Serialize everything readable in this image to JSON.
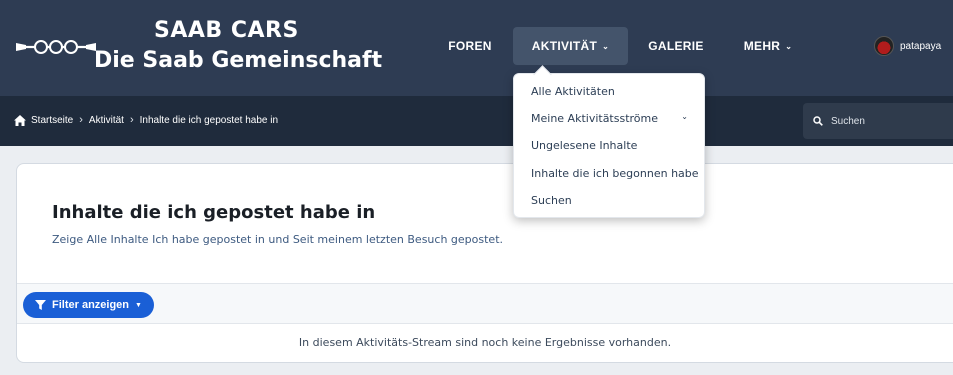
{
  "brand": {
    "line1": "SAAB CARS",
    "line2": "Die Saab Gemeinschaft",
    "logo_icon": "saab-propeller-logo"
  },
  "nav": {
    "items": [
      {
        "label": "FOREN"
      },
      {
        "label": "AKTIVITÄT"
      },
      {
        "label": "GALERIE"
      },
      {
        "label": "MEHR"
      }
    ]
  },
  "user": {
    "name": "patapaya"
  },
  "breadcrumb": {
    "home": "Startseite",
    "level1": "Aktivität",
    "current": "Inhalte die ich gepostet habe in"
  },
  "search": {
    "placeholder": "Suchen"
  },
  "dropdown": {
    "items": [
      {
        "label": "Alle Aktivitäten"
      },
      {
        "label": "Meine Aktivitätsströme"
      },
      {
        "label": "Ungelesene Inhalte"
      },
      {
        "label": "Inhalte die ich begonnen habe"
      },
      {
        "label": "Suchen"
      }
    ]
  },
  "page": {
    "title": "Inhalte die ich gepostet habe in",
    "subtitle": "Zeige Alle Inhalte Ich habe gepostet in und Seit meinem letzten Besuch gepostet.",
    "filter_label": "Filter anzeigen",
    "empty_message": "In diesem Aktivitäts-Stream sind noch keine Ergebnisse vorhanden."
  },
  "colors": {
    "header": "#2e3c53",
    "crumbbar": "#1f2b3c",
    "accent": "#1a5fd6"
  }
}
